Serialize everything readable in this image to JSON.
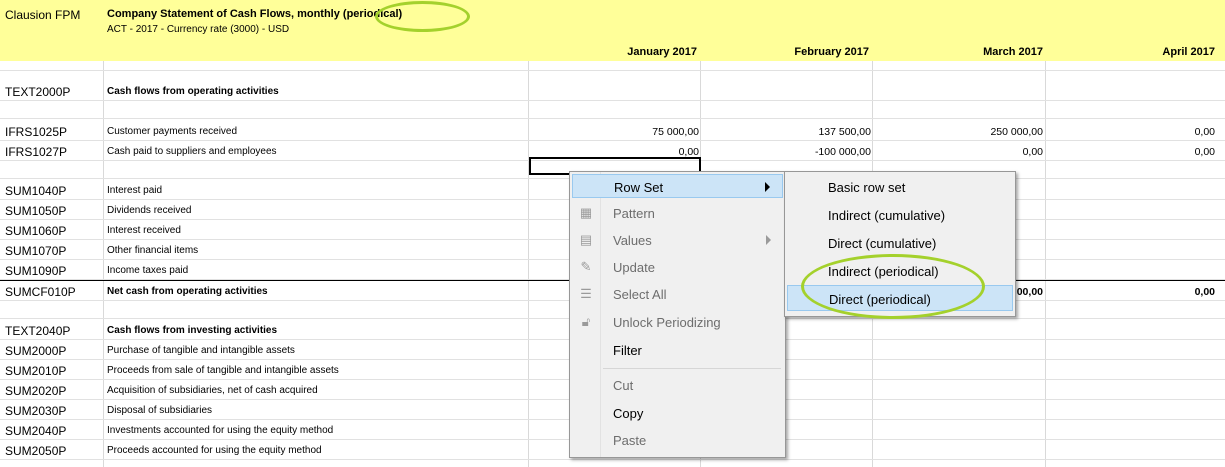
{
  "header": {
    "brand": "Clausion FPM",
    "title": "Company Statement of Cash Flows, monthly (periodical)",
    "subtitle": "ACT - 2017 - Currency rate (3000) - USD",
    "columns": [
      "January 2017",
      "February 2017",
      "March 2017",
      "April 2017"
    ]
  },
  "rows": [
    {
      "code": "TEXT2000P",
      "label": "Cash flows from operating activities",
      "bold": true
    },
    {
      "code": "IFRS1025P",
      "label": "Customer payments received",
      "values": [
        "75 000,00",
        "137 500,00",
        "250 000,00",
        "0,00"
      ]
    },
    {
      "code": "IFRS1027P",
      "label": "Cash paid to suppliers and employees",
      "values": [
        "0,00",
        "-100 000,00",
        "0,00",
        "0,00"
      ]
    },
    {
      "code": "SUM1040P",
      "label": "Interest paid"
    },
    {
      "code": "SUM1050P",
      "label": "Dividends received"
    },
    {
      "code": "SUM1060P",
      "label": "Interest received"
    },
    {
      "code": "SUM1070P",
      "label": "Other financial items"
    },
    {
      "code": "SUM1090P",
      "label": "Income taxes paid"
    },
    {
      "code": "SUMCF010P",
      "label": "Net cash from operating activities",
      "bold": true,
      "values": [
        "",
        "",
        "00,00",
        "0,00"
      ]
    },
    {
      "code": "TEXT2040P",
      "label": "Cash flows from investing activities",
      "bold": true
    },
    {
      "code": "SUM2000P",
      "label": "Purchase of tangible and intangible assets"
    },
    {
      "code": "SUM2010P",
      "label": "Proceeds from sale of tangible and intangible assets"
    },
    {
      "code": "SUM2020P",
      "label": "Acquisition of subsidiaries, net of cash acquired"
    },
    {
      "code": "SUM2030P",
      "label": "Disposal of subsidiaries"
    },
    {
      "code": "SUM2040P",
      "label": "Investments accounted for using the equity method"
    },
    {
      "code": "SUM2050P",
      "label": "Proceeds accounted for using the equity method"
    }
  ],
  "context_menu": {
    "items": [
      {
        "label": "Row Set",
        "icon": "",
        "enabled": true,
        "submenu": true
      },
      {
        "label": "Pattern",
        "icon": "grid-icon",
        "enabled": false
      },
      {
        "label": "Values",
        "icon": "values-icon",
        "enabled": false,
        "submenu": true
      },
      {
        "label": "Update",
        "icon": "update-icon",
        "enabled": false
      },
      {
        "label": "Select All",
        "icon": "select-all-icon",
        "enabled": false
      },
      {
        "label": "Unlock Periodizing",
        "icon": "unlock-icon",
        "enabled": false
      },
      {
        "label": "Filter",
        "icon": "",
        "enabled": true
      },
      {
        "label": "Cut",
        "icon": "",
        "enabled": false
      },
      {
        "label": "Copy",
        "icon": "",
        "enabled": true
      },
      {
        "label": "Paste",
        "icon": "",
        "enabled": false
      }
    ]
  },
  "submenu": {
    "items": [
      {
        "label": "Basic row set"
      },
      {
        "label": "Indirect (cumulative)"
      },
      {
        "label": "Direct (cumulative)"
      },
      {
        "label": "Indirect (periodical)"
      },
      {
        "label": "Direct (periodical)",
        "selected": true
      }
    ]
  },
  "colors": {
    "header_bg": "#ffff99",
    "menu_highlight": "#cce4f7",
    "annotation": "#a4d12c"
  }
}
